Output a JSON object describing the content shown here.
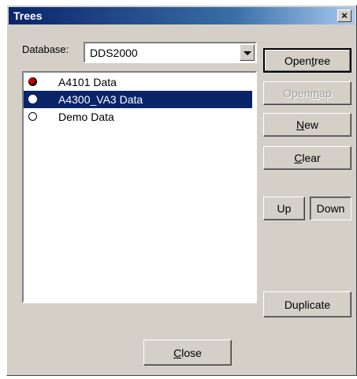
{
  "window": {
    "title": "Trees",
    "close_glyph": "×"
  },
  "database": {
    "label": "Database:",
    "value": "DDS2000"
  },
  "trees": [
    {
      "label": "A4101 Data",
      "state": "open",
      "selected": false
    },
    {
      "label": "A4300_VA3 Data",
      "state": "filled",
      "selected": true
    },
    {
      "label": "Demo Data",
      "state": "empty",
      "selected": false
    }
  ],
  "buttons": {
    "open_tree": {
      "pre": "Open ",
      "hot": "t",
      "post": "ree"
    },
    "open_map": {
      "pre": "Open ",
      "hot": "m",
      "post": "ap"
    },
    "new": {
      "pre": "",
      "hot": "N",
      "post": "ew"
    },
    "clear": {
      "pre": "",
      "hot": "C",
      "post": "lear"
    },
    "up": "Up",
    "down": "Down",
    "duplicate": "Duplicate",
    "close": {
      "pre": "",
      "hot": "C",
      "post": "lose"
    }
  },
  "colors": {
    "selection": "#0a246a",
    "face": "#d4d0c8"
  }
}
